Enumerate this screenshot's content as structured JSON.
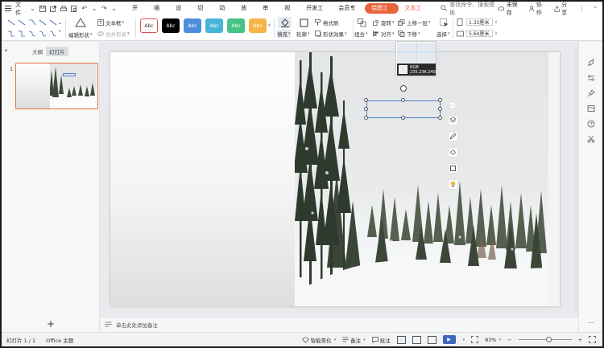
{
  "menubar": {
    "file_label": "文件",
    "menus": [
      {
        "label": "开始",
        "state": "normal"
      },
      {
        "label": "插入",
        "state": "normal"
      },
      {
        "label": "设计",
        "state": "normal"
      },
      {
        "label": "切换",
        "state": "normal"
      },
      {
        "label": "动画",
        "state": "normal"
      },
      {
        "label": "放映",
        "state": "normal"
      },
      {
        "label": "审阅",
        "state": "normal"
      },
      {
        "label": "视图",
        "state": "normal"
      },
      {
        "label": "开发工具",
        "state": "normal"
      },
      {
        "label": "会员专享",
        "state": "normal"
      },
      {
        "label": "绘图工具",
        "state": "active"
      },
      {
        "label": "文本工具",
        "state": "accent"
      }
    ],
    "search_text": "查找命令、搜索模板",
    "unsaved_label": "未保存",
    "collab_label": "协作",
    "share_label": "分享"
  },
  "ribbon": {
    "edit_shape": "编辑形状",
    "textbox": "文本框",
    "merge_shape": "合并形状",
    "style_label": "Abc",
    "fill": "填充",
    "outline": "轮廓",
    "format_painter": "格式刷",
    "shape_effect": "形状效果",
    "rotate": "旋转",
    "bring_forward": "上移一层",
    "group": "组合",
    "align": "对齐",
    "send_backward": "下移",
    "select": "选择",
    "height_value": "1.33厘米",
    "width_value": "5.64厘米"
  },
  "left_panel": {
    "tab_outline": "大纲",
    "tab_slides": "幻灯片",
    "slide_number": "1"
  },
  "color_picker": {
    "label": "RGB",
    "value": "235,236,240",
    "color": "#ebecf0"
  },
  "notes": {
    "placeholder": "单击此处添加备注"
  },
  "status": {
    "slide_info": "幻灯片 1 / 1",
    "theme": "Office 主题",
    "beautify": "智能美化",
    "notes_label": "备注",
    "comments_label": "批注",
    "zoom": "83%",
    "zoom_fraction": 0.58
  },
  "colors": {
    "accent": "#e8643a",
    "selection": "#4a7fc4",
    "style_white": "#ffffff",
    "style_black": "#000000",
    "style_blue": "#4c8edb",
    "style_teal": "#45b5da",
    "style_green": "#49c285",
    "style_orange": "#f5b547"
  }
}
